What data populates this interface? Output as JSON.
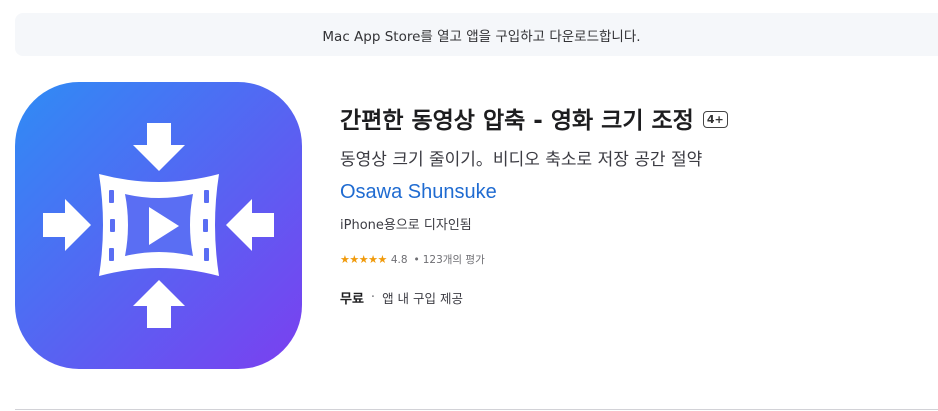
{
  "banner": {
    "text": "Mac App Store를 열고 앱을 구입하고 다운로드합니다."
  },
  "app": {
    "icon_name": "video-compress-icon",
    "title": "간편한 동영상 압축 - 영화 크기 조정",
    "age_rating": "4+",
    "subtitle": "동영상 크기 줄이기。비디오 축소로 저장 공간 절약",
    "developer": "Osawa Shunsuke",
    "designed_for": "iPhone용으로 디자인됨",
    "rating": {
      "stars": "★★★★★",
      "value": "4.8",
      "separator": "•",
      "count_label": "123개의 평가"
    },
    "price": "무료",
    "price_separator": "·",
    "iap": "앱 내 구입 제공"
  },
  "colors": {
    "icon_gradient_start": "#2f8cf5",
    "icon_gradient_end": "#7b3ff0",
    "link": "#1f6bd1",
    "stars": "#f09a0b"
  }
}
